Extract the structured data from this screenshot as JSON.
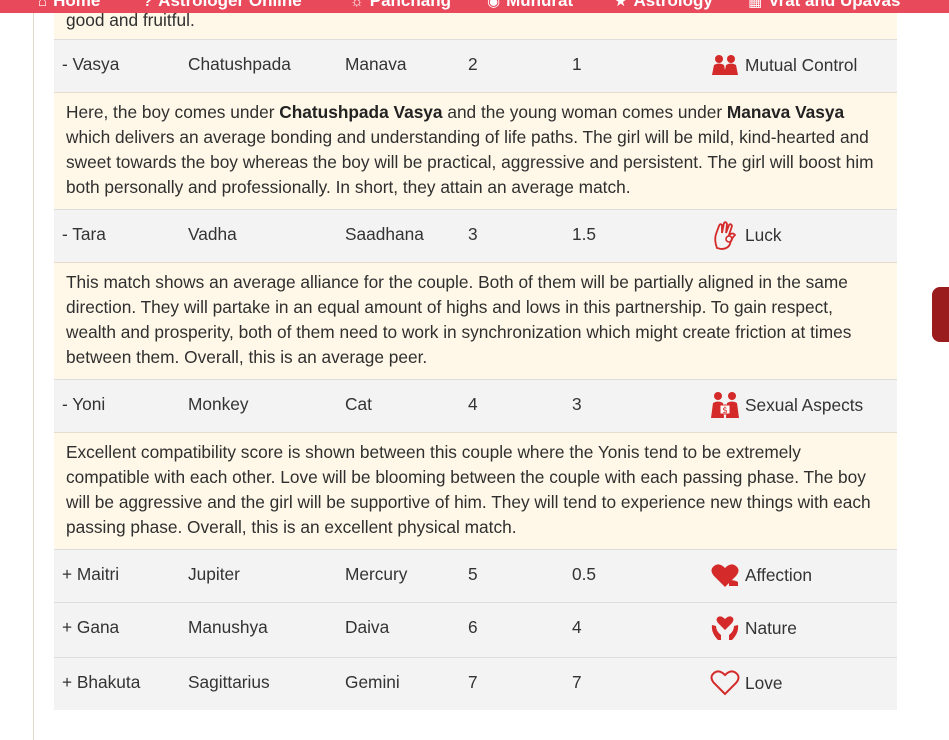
{
  "nav": {
    "items": [
      {
        "label": "Home",
        "icon": "home-icon"
      },
      {
        "label": "Astrologer Online",
        "icon": "question-icon"
      },
      {
        "label": "Panchang",
        "icon": "sun-icon"
      },
      {
        "label": "Muhurat",
        "icon": "check-circle-icon"
      },
      {
        "label": "Astrology",
        "icon": "star-icon"
      },
      {
        "label": "Vrat and Upavas",
        "icon": "calendar-icon"
      }
    ]
  },
  "intro_tail": "good and fruitful.",
  "rows": [
    {
      "name": "- Vasya",
      "boy": "Chatushpada",
      "girl": "Manava",
      "max": "2",
      "received": "1",
      "area": "Mutual Control",
      "icon": "couple-icon",
      "desc": {
        "p1": "Here, the boy comes under ",
        "b1": "Chatushpada Vasya",
        "p2": " and the young woman comes under ",
        "b2": "Manava Vasya",
        "p3": " which delivers an average bonding and understanding of life paths. The girl will be mild, kind-hearted and sweet towards the boy whereas the boy will be practical, aggressive and persistent. The girl will boost him both personally and professionally. In short, they attain an average match."
      }
    },
    {
      "name": "- Tara",
      "boy": "Vadha",
      "girl": "Saadhana",
      "max": "3",
      "received": "1.5",
      "area": "Luck",
      "icon": "ok-hand-icon",
      "desc": "This match shows an average alliance for the couple. Both of them will be partially aligned in the same direction. They will partake in an equal amount of highs and lows in this partnership. To gain respect, wealth and prosperity, both of them need to work in synchronization which might create friction at times between them. Overall, this is an average peer."
    },
    {
      "name": "- Yoni",
      "boy": "Monkey",
      "girl": "Cat",
      "max": "4",
      "received": "3",
      "area": "Sexual Aspects",
      "icon": "people-money-icon",
      "desc": "Excellent compatibility score is shown between this couple where the Yonis tend to be extremely compatible with each other. Love will be blooming between the couple with each passing phase. The boy will be aggressive and the girl will be supportive of him. They will tend to experience new things with each passing phase. Overall, this is an excellent physical match."
    },
    {
      "name": "+ Maitri",
      "boy": "Jupiter",
      "girl": "Mercury",
      "max": "5",
      "received": "0.5",
      "area": "Affection",
      "icon": "hand-heart-icon"
    },
    {
      "name": "+ Gana",
      "boy": "Manushya",
      "girl": "Daiva",
      "max": "6",
      "received": "4",
      "area": "Nature",
      "icon": "hands-heart-icon"
    },
    {
      "name": "+ Bhakuta",
      "boy": "Sagittarius",
      "girl": "Gemini",
      "max": "7",
      "received": "7",
      "area": "Love",
      "icon": "heart-outline-icon"
    }
  ],
  "colors": {
    "accent": "#e8495b",
    "icon_red": "#d42a2a",
    "desc_bg": "#fff8e8",
    "row_bg": "#f3f3f3"
  }
}
